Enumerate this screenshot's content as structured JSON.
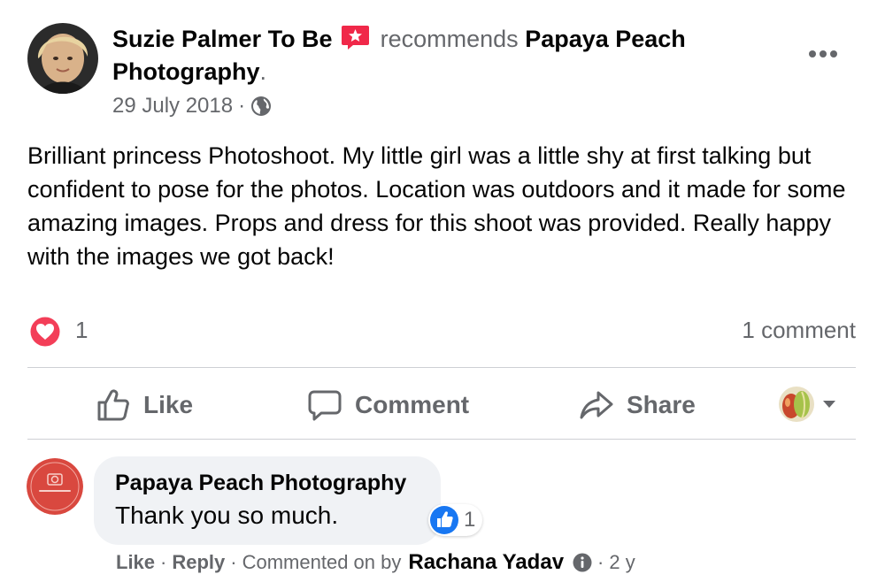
{
  "post": {
    "author": "Suzie Palmer To Be",
    "recommends_text": "recommends",
    "page_name": "Papaya Peach Photography",
    "title_period": ".",
    "date": "29 July 2018",
    "date_sep": "·",
    "audience_icon": "globe-icon",
    "text": "Brilliant princess Photoshoot. My little girl was a little shy at first talking but confident to pose for the photos. Location was outdoors and it made for some amazing images. Props and dress for this shoot was provided. Really happy with the images we got back!"
  },
  "reactions": {
    "icon": "heart-icon",
    "count": "1",
    "comments_label": "1 comment"
  },
  "actions": {
    "like": "Like",
    "comment": "Comment",
    "share": "Share"
  },
  "comment": {
    "author": "Papaya Peach Photography",
    "text": "Thank you so much.",
    "like_count": "1",
    "like_label": "Like",
    "reply_label": "Reply",
    "commented_on_by": "Commented on by",
    "by_name": "Rachana Yadav",
    "age": "2 y",
    "sep": "·"
  },
  "colors": {
    "text": "#050505",
    "muted": "#65676b",
    "heart": "#f33e58",
    "like_blue": "#1877f2",
    "recommend_badge": "#f02849",
    "bubble": "#f0f2f5"
  }
}
